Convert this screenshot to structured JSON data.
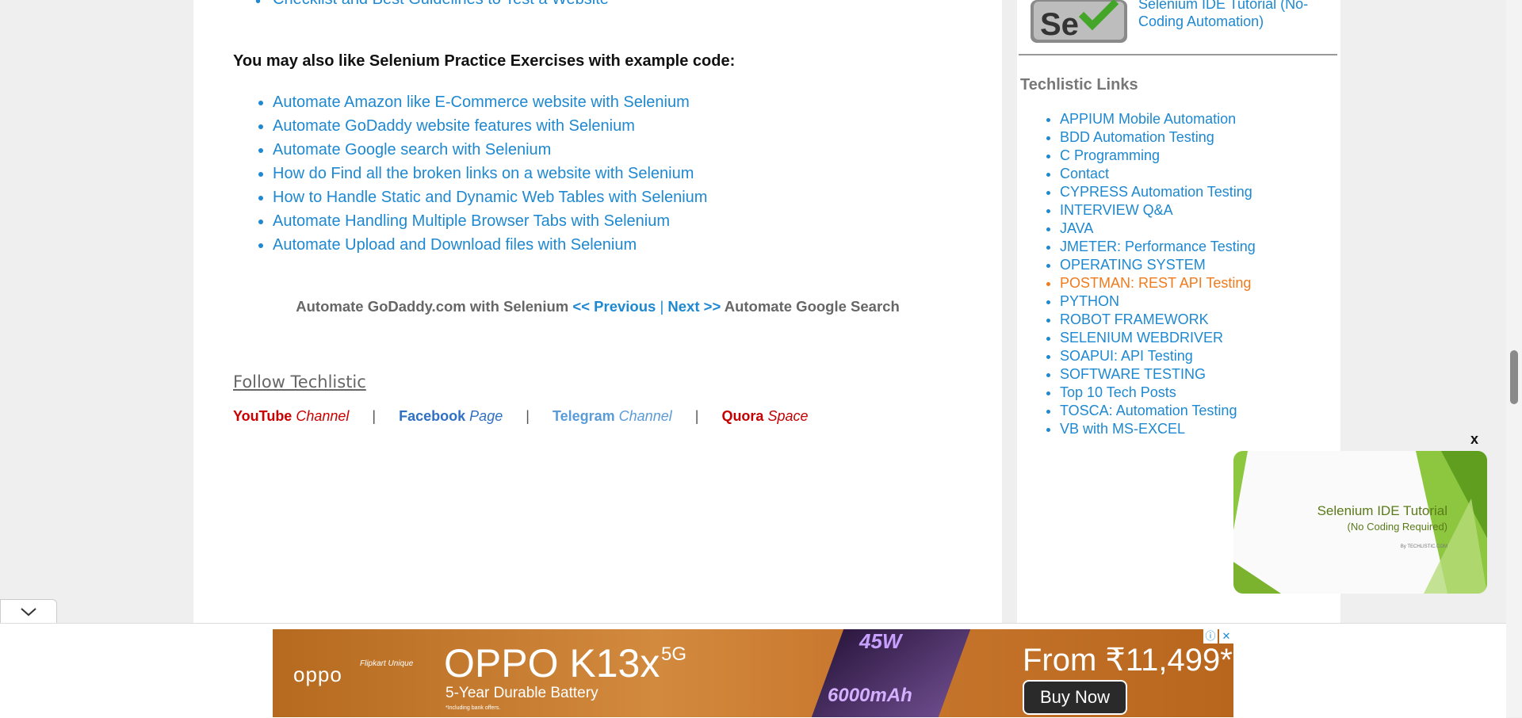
{
  "main": {
    "top_link": "Checklist and Best Guidelines to Test a Website",
    "practice_heading": "You may also like Selenium Practice Exercises with example code:",
    "practice_links": [
      "Automate Amazon like E-Commerce website with Selenium",
      "Automate GoDaddy website features with Selenium",
      "Automate Google search with Selenium",
      "How do Find all the broken links on a website with Selenium",
      "How to Handle Static and Dynamic Web Tables with Selenium",
      "Automate Handling Multiple Browser Tabs with Selenium",
      "Automate Upload and Download files with Selenium"
    ],
    "pager": {
      "prev_title": "Automate GoDaddy.com with Selenium",
      "prev_label": "<< Previous",
      "separator": "|",
      "next_label": "Next  >>",
      "next_title": "Automate Google Search"
    },
    "follow": {
      "title": "Follow Techlistic",
      "divider": "|",
      "youtube": {
        "name": "YouTube",
        "kind": "Channel"
      },
      "facebook": {
        "name": "Facebook",
        "kind": "Page"
      },
      "telegram": {
        "name": "Telegram",
        "kind": "Channel"
      },
      "quora": {
        "name": "Quora",
        "kind": "Space"
      }
    }
  },
  "sidebar": {
    "selenium_ide_link": "Selenium IDE Tutorial (No-Coding Automation)",
    "logo_text": "Se",
    "links_title": "Techlistic Links",
    "links": [
      "APPIUM Mobile Automation",
      "BDD Automation Testing",
      "C Programming",
      "Contact",
      "CYPRESS Automation Testing",
      "INTERVIEW Q&A",
      "JAVA",
      "JMETER: Performance Testing",
      "OPERATING SYSTEM",
      "POSTMAN: REST API Testing",
      "PYTHON",
      "ROBOT FRAMEWORK",
      "SELENIUM WEBDRIVER",
      "SOAPUI: API Testing",
      "SOFTWARE TESTING",
      "Top 10 Tech Posts",
      "TOSCA: Automation Testing",
      "VB with MS-EXCEL"
    ],
    "highlighted_index": 9
  },
  "video": {
    "close": "x",
    "title": "Selenium IDE Tutorial",
    "subtitle": "(No Coding Required)",
    "byline": "By TECHLISTIC.COM"
  },
  "ad": {
    "brand": "oppo",
    "partner": "Flipkart Unique",
    "model": "OPPO K13x",
    "model_sup": "5G",
    "tagline": "5-Year Durable Battery",
    "fine_print": "*Including bank offers.",
    "watt": "45W",
    "battery": "6000mAh",
    "price": "From ₹11,499*",
    "cta": "Buy Now",
    "info_icon": "ⓘ",
    "close_icon": "✕"
  },
  "colors": {
    "link": "#1e88d0",
    "highlight": "#f07b1d",
    "youtube": "#cc0000",
    "facebook": "#2f70c4",
    "telegram": "#5a9bd8",
    "quora": "#c40000"
  }
}
